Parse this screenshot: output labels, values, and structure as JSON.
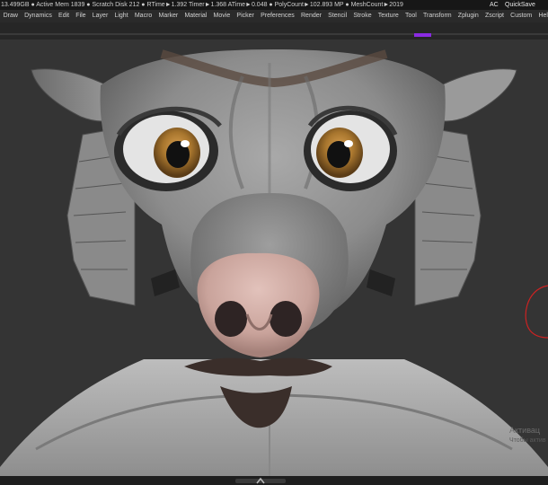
{
  "status": {
    "text": "13.499GB ● Active Mem 1839 ● Scratch Disk 212 ● RTime►1.392 Timer►1.368 ATime►0.048 ● PolyCount►102.893 MP ● MeshCount►2019",
    "ac_label": "AC",
    "quicksave_label": "QuickSave"
  },
  "menu": {
    "items": [
      "Draw",
      "Dynamics",
      "Edit",
      "File",
      "Layer",
      "Light",
      "Macro",
      "Marker",
      "Material",
      "Movie",
      "Picker",
      "Preferences",
      "Render",
      "Stencil",
      "Stroke",
      "Texture",
      "Tool",
      "Transform",
      "Zplugin",
      "Zscript",
      "Custom",
      "Help"
    ]
  },
  "viewport": {
    "background_color": "#343434",
    "model": "sculpted-creature-head",
    "brush_cursor_color": "#cc2222"
  },
  "watermark": {
    "line1": "Активац",
    "line2": "Чтобы актив"
  },
  "colors": {
    "accent": "#8a2be2",
    "menubar": "#2a2a2a",
    "statusbar": "#171717"
  }
}
